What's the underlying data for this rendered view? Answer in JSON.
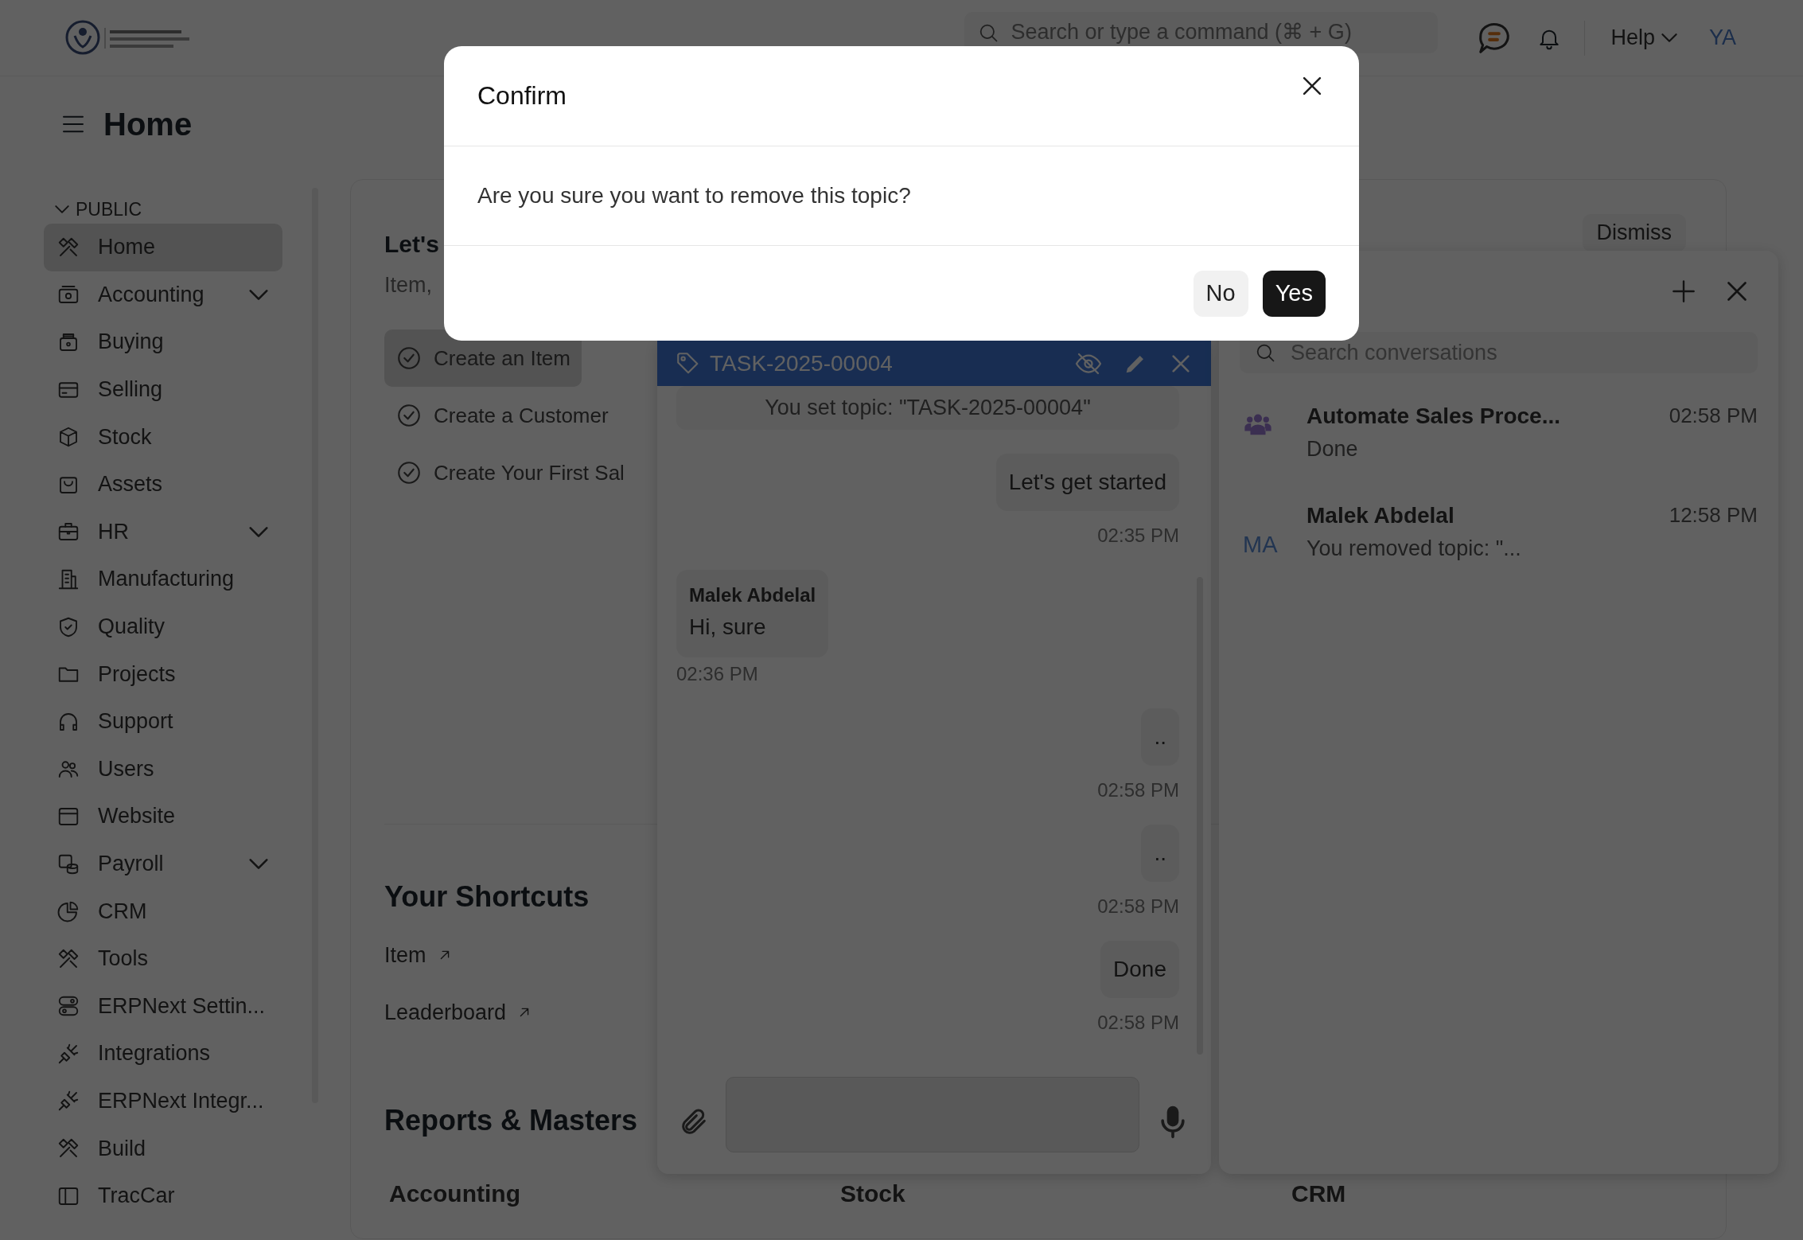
{
  "topbar": {
    "search": {
      "placeholder": "Search or type a command (⌘ + G)"
    },
    "help": "Help",
    "avatar": "YA"
  },
  "page": {
    "title": "Home"
  },
  "sidebar": {
    "section": "PUBLIC",
    "items": [
      {
        "label": "Home",
        "selected": true,
        "expandable": false
      },
      {
        "label": "Accounting",
        "selected": false,
        "expandable": true
      },
      {
        "label": "Buying",
        "selected": false,
        "expandable": false
      },
      {
        "label": "Selling",
        "selected": false,
        "expandable": false
      },
      {
        "label": "Stock",
        "selected": false,
        "expandable": false
      },
      {
        "label": "Assets",
        "selected": false,
        "expandable": false
      },
      {
        "label": "HR",
        "selected": false,
        "expandable": true
      },
      {
        "label": "Manufacturing",
        "selected": false,
        "expandable": false
      },
      {
        "label": "Quality",
        "selected": false,
        "expandable": false
      },
      {
        "label": "Projects",
        "selected": false,
        "expandable": false
      },
      {
        "label": "Support",
        "selected": false,
        "expandable": false
      },
      {
        "label": "Users",
        "selected": false,
        "expandable": false
      },
      {
        "label": "Website",
        "selected": false,
        "expandable": false
      },
      {
        "label": "Payroll",
        "selected": false,
        "expandable": true
      },
      {
        "label": "CRM",
        "selected": false,
        "expandable": false
      },
      {
        "label": "Tools",
        "selected": false,
        "expandable": false
      },
      {
        "label": "ERPNext Settin...",
        "selected": false,
        "expandable": false
      },
      {
        "label": "Integrations",
        "selected": false,
        "expandable": false
      },
      {
        "label": "ERPNext Integr...",
        "selected": false,
        "expandable": false
      },
      {
        "label": "Build",
        "selected": false,
        "expandable": false
      },
      {
        "label": "TracCar",
        "selected": false,
        "expandable": false
      }
    ]
  },
  "onboarding": {
    "title": "Let's",
    "subtitle": "Item,",
    "dismiss": "Dismiss",
    "steps": [
      {
        "label": "Create an Item",
        "selected": true
      },
      {
        "label": "Create a Customer",
        "selected": false
      },
      {
        "label": "Create Your First Sal",
        "selected": false
      }
    ]
  },
  "shortcuts": {
    "title": "Your Shortcuts",
    "items": [
      "Item",
      "Leaderboard"
    ]
  },
  "reports": {
    "title": "Reports & Masters",
    "columns": [
      "Accounting",
      "Stock",
      "CRM"
    ]
  },
  "chat_window": {
    "topic": "TASK-2025-00004",
    "messages": [
      {
        "kind": "system",
        "text": "You set topic: \"TASK-2025-00004\""
      },
      {
        "kind": "outgoing",
        "text": "Let's get started",
        "time": "02:35 PM"
      },
      {
        "kind": "incoming",
        "sender": "Malek Abdelal",
        "text": "Hi, sure",
        "time": "02:36 PM"
      },
      {
        "kind": "outgoing",
        "text": "..",
        "time": "02:58 PM"
      },
      {
        "kind": "outgoing",
        "text": "..",
        "time": "02:58 PM"
      },
      {
        "kind": "outgoing",
        "text": "Done",
        "time": "02:58 PM"
      }
    ]
  },
  "chat_panel": {
    "search": {
      "placeholder": "Search conversations"
    },
    "conversations": [
      {
        "kind": "group",
        "title": "Automate Sales Proce...",
        "preview": "Done",
        "time": "02:58 PM"
      },
      {
        "kind": "initials",
        "initials": "MA",
        "title": "Malek Abdelal",
        "preview": "You removed topic: \"...",
        "time": "12:58 PM"
      }
    ]
  },
  "dialog": {
    "title": "Confirm",
    "message": "Are you sure you want to remove this topic?",
    "buttons": [
      {
        "label": "No",
        "kind": "secondary"
      },
      {
        "label": "Yes",
        "kind": "primary"
      }
    ]
  }
}
